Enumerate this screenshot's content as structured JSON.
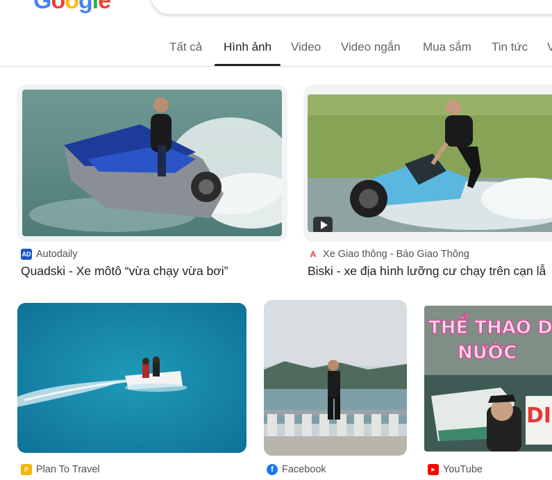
{
  "logo": "Google",
  "search": {
    "query": ""
  },
  "tabs": [
    {
      "label": "Tất cả"
    },
    {
      "label": "Hình ảnh"
    },
    {
      "label": "Video"
    },
    {
      "label": "Video ngắn"
    },
    {
      "label": "Mua sắm"
    },
    {
      "label": "Tin tức"
    },
    {
      "label": "V"
    }
  ],
  "active_tab": "Hình ảnh",
  "results": [
    {
      "source": "Autodaily",
      "favicon": "AD",
      "favicon_color": "#1a57c4",
      "title": "Quadski - Xe môtô “vừa chạy vừa bơi”"
    },
    {
      "source": "Xe Giao thông - Báo Giao Thông",
      "favicon": "A",
      "favicon_color": "#e53935",
      "title": "Biski - xe địa hình lưỡng cư chạy trên cạn lẫ",
      "video": true
    },
    {
      "source": "Plan To Travel",
      "favicon": "P",
      "favicon_color": "#f4b400",
      "title": ""
    },
    {
      "source": "Facebook",
      "favicon": "f",
      "favicon_color": "#1877f2",
      "title": ""
    },
    {
      "source": "YouTube",
      "favicon": "▶",
      "favicon_color": "#ff0000",
      "title": "",
      "overlay_text_1": "THỂ THAO DƯỚI",
      "overlay_text_2": "NƯỚC",
      "overlay_text_3": "DI"
    }
  ]
}
